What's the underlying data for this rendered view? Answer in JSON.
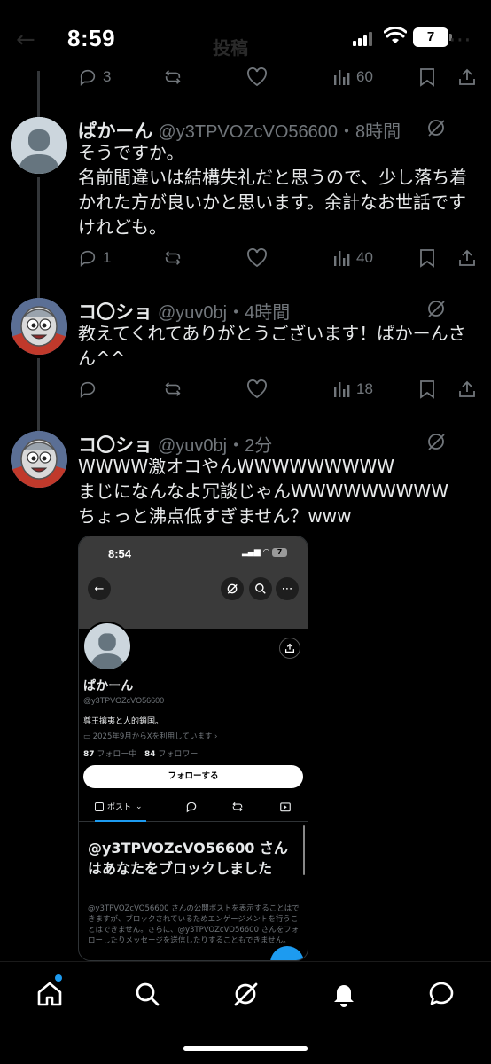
{
  "status_bar": {
    "time": "8:59",
    "battery": "7",
    "ghost_title": "投稿"
  },
  "top_actions": {
    "reply_count": "3",
    "view_count": "60"
  },
  "tweets": [
    {
      "name": "ぱかーん",
      "handle": "@y3TPVOZcVO56600・8時間",
      "text": "そうですか。\n名前間違いは結構失礼だと思うので、少し落ち着かれた方が良いかと思います。余計なお世話ですけれども。",
      "reply_count": "1",
      "view_count": "40"
    },
    {
      "name": "コ〇ショ",
      "handle": "@yuv0bj・4時間",
      "text": "教えてくれてありがとうございます！ぱかーんさん^^",
      "view_count": "18"
    },
    {
      "name": "コ〇ショ",
      "handle": "@yuv0bj・2分",
      "text": "WWWW激オコやんWWWWWWWWW\nまじになんなよ冗談じゃんWWWWWWWWW\nちょっと沸点低すぎません？www"
    }
  ],
  "embedded": {
    "time": "8:54",
    "battery": "7",
    "name": "ぱかーん",
    "handle": "@y3TPVOZcVO56600",
    "bio": "尊王攘夷と人的鎖国。",
    "joined": "2025年9月からXを利用しています",
    "following_count": "87",
    "following_label": "フォロー中",
    "followers_count": "84",
    "followers_label": "フォロワー",
    "follow_button": "フォローする",
    "tab_posts": "ポスト",
    "blocked_title": "@y3TPVOZcVO56600 さんはあなたをブロックしました",
    "blocked_text": "@y3TPVOZcVO56600 さんの公開ポストを表示することはできますが、ブロックされているためエンゲージメントを行うことはできません。さらに、@y3TPVOZcVO56600 さんをフォローしたりメッセージを送信したりすることもできません。"
  },
  "colors": {
    "background": "#000000",
    "text": "#e7e9ea",
    "muted": "#71767b",
    "accent": "#1d9bf0"
  },
  "icons": [
    "reply-icon",
    "repost-icon",
    "like-icon",
    "views-icon",
    "bookmark-icon",
    "share-icon",
    "grok-icon",
    "home-icon",
    "search-icon",
    "grok-nav-icon",
    "notifications-icon",
    "messages-icon"
  ]
}
